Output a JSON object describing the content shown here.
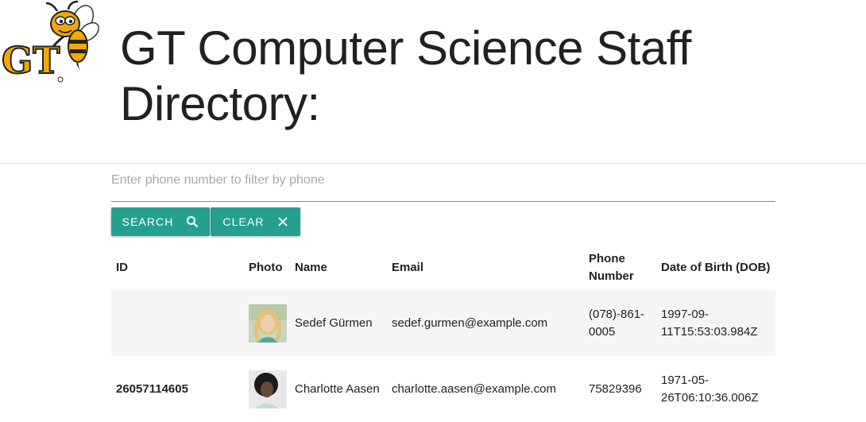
{
  "header": {
    "title": "GT Computer Science Staff Directory:",
    "logo_text": "GT"
  },
  "search": {
    "placeholder": "Enter phone number to filter by phone",
    "value": ""
  },
  "buttons": {
    "search_label": "SEARCH",
    "search_icon": "search-icon",
    "clear_label": "CLEAR",
    "clear_icon": "close-icon"
  },
  "table": {
    "columns": [
      "ID",
      "Photo",
      "Name",
      "Email",
      "Phone Number",
      "Date of Birth (DOB)"
    ],
    "rows": [
      {
        "id": "",
        "photo": "avatar-blonde-woman",
        "name": "Sedef Gürmen",
        "email": "sedef.gurmen@example.com",
        "phone": "(078)-861-0005",
        "dob": "1997-09-11T15:53:03.984Z"
      },
      {
        "id": "26057114605",
        "photo": "avatar-dark-hair-woman",
        "name": "Charlotte Aasen",
        "email": "charlotte.aasen@example.com",
        "phone": "75829396",
        "dob": "1971-05-26T06:10:36.006Z"
      }
    ]
  },
  "colors": {
    "accent": "#26a08e",
    "gt_gold": "#f2a900",
    "row_stripe": "#f5f5f5"
  }
}
